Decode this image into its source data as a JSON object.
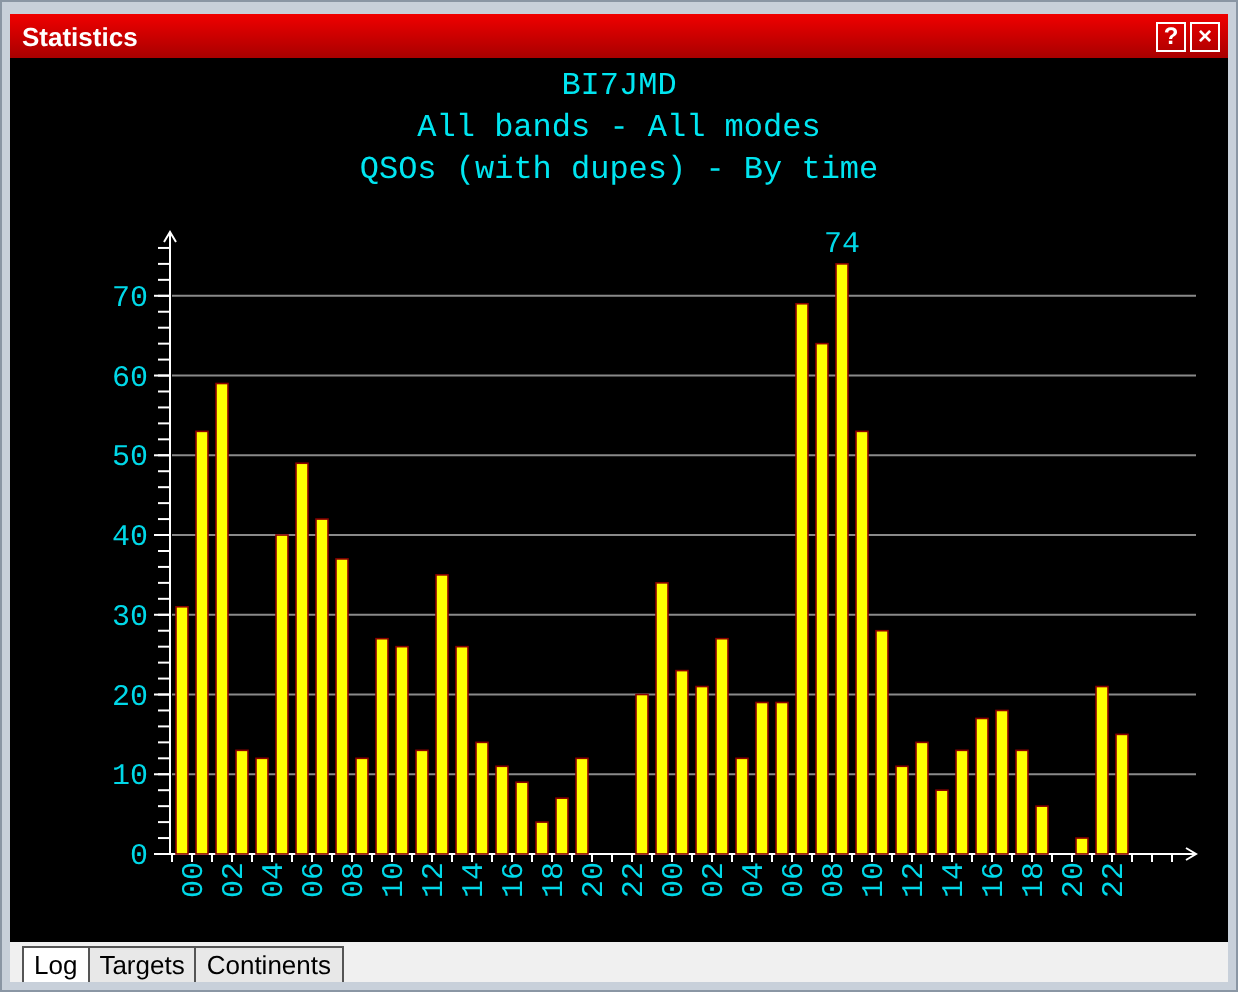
{
  "window": {
    "title": "Statistics",
    "buttons": [
      "?",
      "×"
    ]
  },
  "chart": {
    "titles": [
      "BI7JMD",
      "All bands - All modes"
    ],
    "chart_data": {
      "type": "bar",
      "title": "QSOs (with dupes) - By time",
      "grid": true,
      "ylim": [
        0,
        78
      ],
      "yticks": [
        0,
        10,
        20,
        30,
        40,
        50,
        60,
        70
      ],
      "values": [
        31,
        53,
        59,
        13,
        12,
        40,
        49,
        42,
        37,
        12,
        27,
        26,
        13,
        35,
        26,
        14,
        11,
        9,
        4,
        7,
        12,
        0,
        0,
        20,
        34,
        23,
        21,
        27,
        12,
        19,
        19,
        69,
        64,
        74,
        53,
        28,
        11,
        14,
        8,
        13,
        17,
        18,
        13,
        6,
        0,
        2,
        21,
        15,
        null,
        null,
        null
      ]
    },
    "x_labels": [
      "00",
      "02",
      "04",
      "06",
      "08",
      "10",
      "12",
      "14",
      "16",
      "18",
      "20",
      "22",
      "00",
      "02",
      "04",
      "06",
      "08",
      "10",
      "12",
      "14",
      "16",
      "18",
      "20",
      "22"
    ],
    "peak_label": "74"
  },
  "tabs": [
    {
      "label": "Log",
      "selected": true
    },
    {
      "label": "Targets",
      "selected": false
    },
    {
      "label": "Continents",
      "selected": false
    }
  ]
}
